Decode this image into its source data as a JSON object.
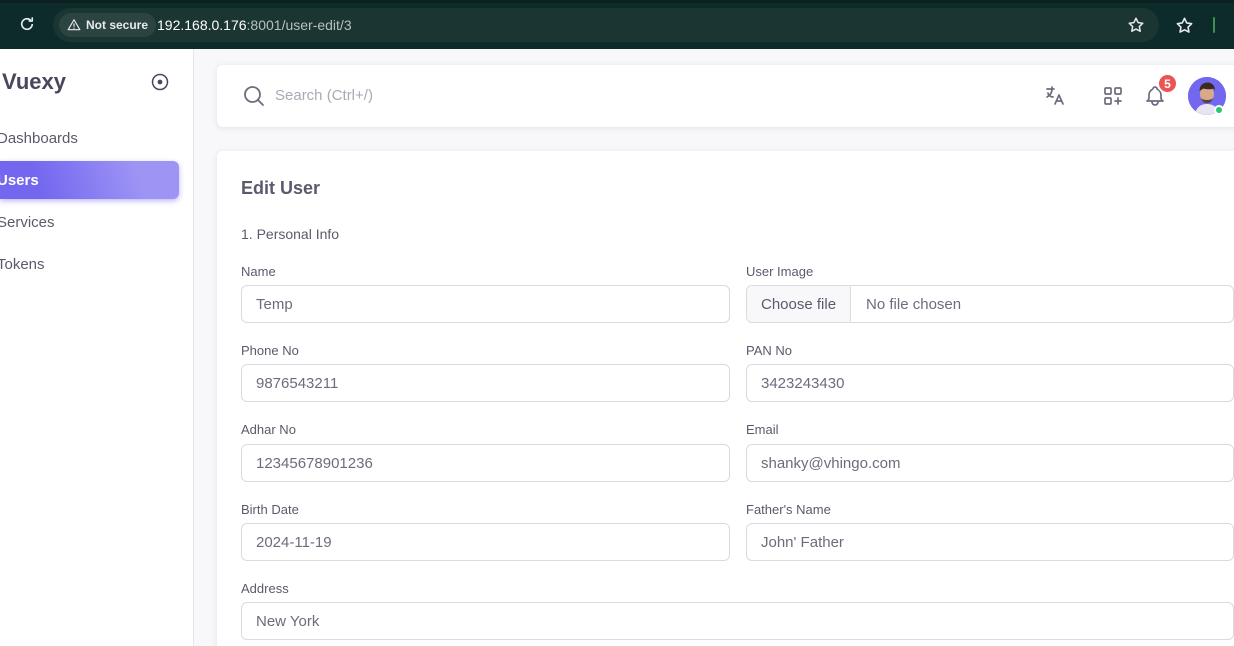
{
  "browser": {
    "security_label": "Not secure",
    "url_host": "192.168.0.176",
    "url_rest": ":8001/user-edit/3"
  },
  "sidebar": {
    "brand": "Vuexy",
    "items": [
      {
        "label": "Dashboards",
        "active": false
      },
      {
        "label": "Users",
        "active": true
      },
      {
        "label": "Services",
        "active": false
      },
      {
        "label": "Tokens",
        "active": false
      }
    ]
  },
  "navbar": {
    "search_placeholder": "Search (Ctrl+/)",
    "notification_count": "5",
    "icons": [
      "translate-icon",
      "shortcuts-icon",
      "bell-icon"
    ]
  },
  "form": {
    "title": "Edit User",
    "section": "1. Personal Info",
    "name_label": "Name",
    "name_value": "Temp",
    "image_label": "User Image",
    "image_button": "Choose file",
    "image_status": "No file chosen",
    "phone_label": "Phone No",
    "phone_value": "9876543211",
    "pan_label": "PAN No",
    "pan_value": "3423243430",
    "adhar_label": "Adhar No",
    "adhar_value": "12345678901236",
    "email_label": "Email",
    "email_value": "shanky@vhingo.com",
    "birth_label": "Birth Date",
    "birth_value": "2024-11-19",
    "father_label": "Father's Name",
    "father_value": "John' Father",
    "address_label": "Address",
    "address_value": "New York"
  },
  "colors": {
    "primary": "#7367f0",
    "badge": "#ea5455",
    "online": "#28c76f",
    "browser_bar": "#0d2b2a"
  }
}
